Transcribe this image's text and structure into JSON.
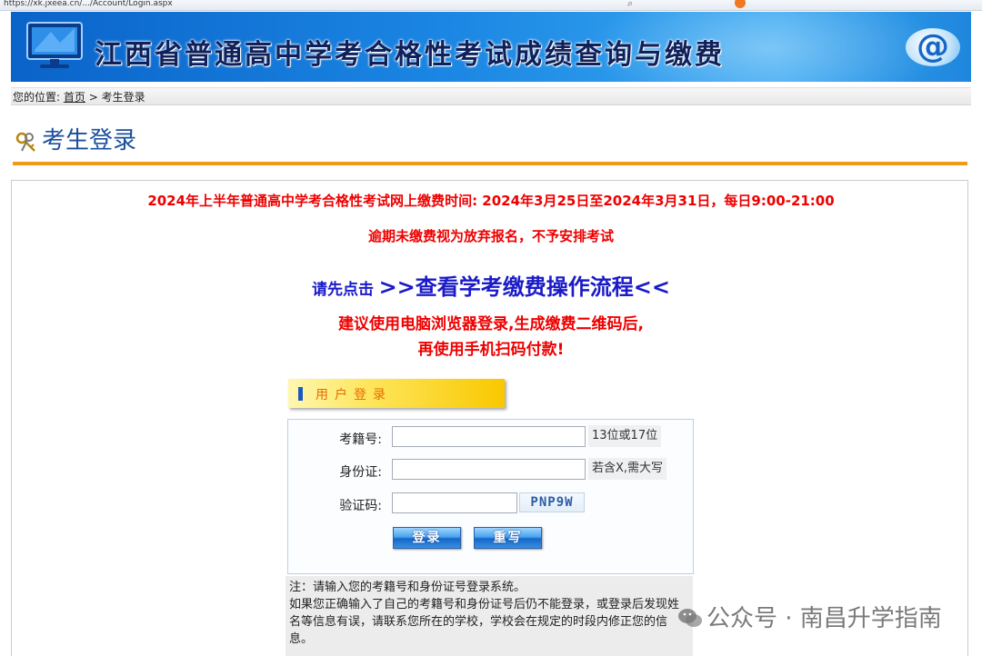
{
  "browser": {
    "address": "https://xk.jxeea.cn/.../Account/Login.aspx"
  },
  "banner": {
    "title": "江西省普通高中学考合格性考试成绩查询与缴费",
    "logo_text": "@"
  },
  "location": {
    "prefix": "您的位置:",
    "home_link": "首页",
    "separator": ">",
    "current": "考生登录"
  },
  "page": {
    "heading": "考生登录"
  },
  "notices": {
    "payment_time": "2024年上半年普通高中学考合格性考试网上缴费时间: 2024年3月25日至2024年3月31日，每日9:00-21:00",
    "overdue": "逾期未缴费视为放弃报名，不予安排考试",
    "guide_prefix": "请先点击",
    "guide_link": ">>查看学考缴费操作流程<<",
    "browser_advice": "建议使用电脑浏览器登录,生成缴费二维码后,",
    "scan_advice": "再使用手机扫码付款!"
  },
  "login": {
    "header": "用户登录",
    "exam_id_label": "考籍号:",
    "exam_id_value": "",
    "exam_id_hint": "13位或17位",
    "id_card_label": "身份证:",
    "id_card_value": "",
    "id_card_hint": "若含X,需大写",
    "captcha_label": "验证码:",
    "captcha_value": "",
    "captcha_code": "PNP9W",
    "login_button": "登录",
    "reset_button": "重写"
  },
  "note": {
    "line1": "注：请输入您的考籍号和身份证号登录系统。",
    "line2": "如果您正确输入了自己的考籍号和身份证号后仍不能登录，或登录后发现姓名等信息有误，请联系您所在的学校，学校会在规定的时段内修正您的信息。"
  },
  "watermark": {
    "text": "公众号 · 南昌升学指南"
  },
  "colors": {
    "banner_blue": "#1b86e3",
    "notice_red": "#ee0000",
    "link_blue": "#1a1ac8",
    "rule_orange": "#f29a13",
    "heading_blue": "#1a4f9c"
  }
}
